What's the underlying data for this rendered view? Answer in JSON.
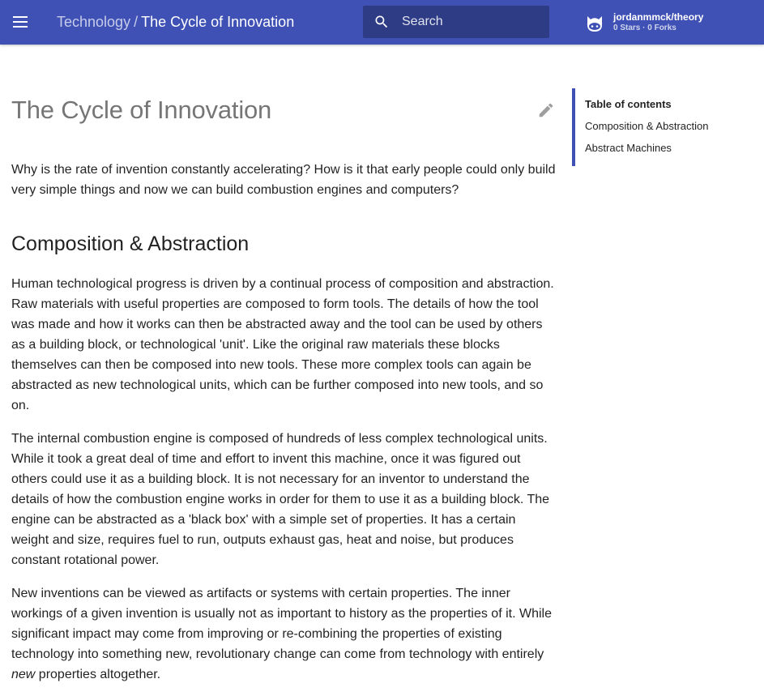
{
  "header": {
    "breadcrumb_parent": "Technology",
    "breadcrumb_separator": "/",
    "breadcrumb_current": "The Cycle of Innovation",
    "search_placeholder": "Search",
    "repo_name": "jordanmmck/theory",
    "repo_facts": "0 Stars · 0 Forks",
    "colors": {
      "primary": "#3f51b5",
      "accent": "#3f51b5"
    }
  },
  "icons": {
    "menu": "menu-icon",
    "search": "search-icon",
    "repo": "github-icon",
    "edit": "pencil-icon"
  },
  "article": {
    "title": "The Cycle of Innovation",
    "intro": "Why is the rate of invention constantly accelerating? How is it that early people could only build very simple things and now we can build combustion engines and computers?",
    "section_heading": "Composition & Abstraction",
    "p1": "Human technological progress is driven by a continual process of composition and abstraction. Raw materials with useful properties are composed to form tools. The details of how the tool was made and how it works can then be abstracted away and the tool can be used by others as a building block, or technological 'unit'. Like the original raw materials these blocks themselves can then be composed into new tools. These more complex tools can again be abstracted as new technological units, which can be further composed into new tools, and so on.",
    "p2": "The internal combustion engine is composed of hundreds of less complex technological units. While it took a great deal of time and effort to invent this machine, once it was figured out others could use it as a building block. It is not necessary for an inventor to understand the details of how the combustion engine works in order for them to use it as a building block. The engine can be abstracted as a 'black box' with a simple set of properties. It has a certain weight and size, requires fuel to run, outputs exhaust gas, heat and noise, but produces constant rotational power.",
    "p3_main": "New inventions can be viewed as artifacts or systems with certain properties. The inner workings of a given invention is usually not as important to history as the properties of it. While significant impact may come from improving or re-combining the properties of existing technology into something new, revolutionary change can come from technology with entirely ",
    "p3_emphasis": "new",
    "p3_end": " properties altogether."
  },
  "toc": {
    "title": "Table of contents",
    "items": [
      {
        "label": "Composition & Abstraction"
      },
      {
        "label": "Abstract Machines"
      }
    ]
  }
}
